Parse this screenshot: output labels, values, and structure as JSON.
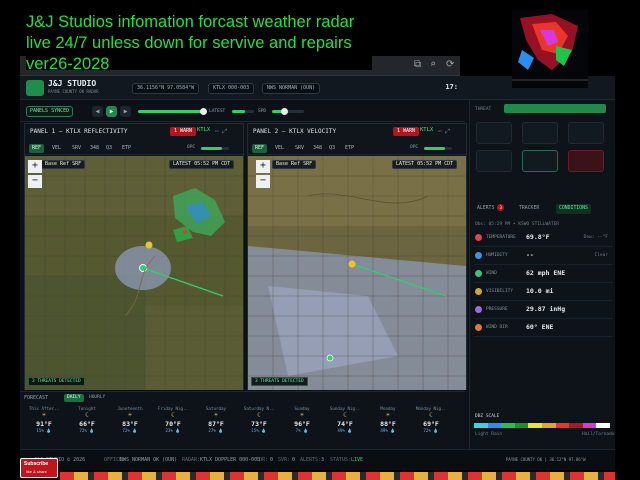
{
  "overlay": {
    "line1": "J&J Studios infomation forcast weather radar",
    "line2": "live 24/7 unless down for servive and repairs",
    "line3": "ver26-2028"
  },
  "app": {
    "brand": "J&J STUDIO",
    "brand_sub": "PAYNE COUNTY OK RADAR",
    "coords": "36.1156°N 97.0584°W",
    "site_code": "KTLX 000-003",
    "location": "NWS NORMAN (OUN)",
    "clock": "17:"
  },
  "controls": {
    "panels_synced": "PANELS SYNCED",
    "latest": "LATEST",
    "spd": "SPD"
  },
  "panels": [
    {
      "title": "PANEL 1 — KTLX REFLECTIVITY",
      "warn": "1 WARN",
      "site": "KTLX",
      "products": [
        "REF",
        "VEL",
        "SRV",
        "348",
        "Q3",
        "ETP"
      ],
      "layer": "Base Ref",
      "layer_tag": "SRF",
      "timestamp": "LATEST  05:52 PM CDT",
      "threats": "3 THREATS DETECTED",
      "opc": "OPC"
    },
    {
      "title": "PANEL 2 — KTLX VELOCITY",
      "warn": "1 WARN",
      "site": "KTLX",
      "products": [
        "REF",
        "VEL",
        "SRV",
        "348",
        "Q3",
        "ETP"
      ],
      "layer": "Base Ref",
      "layer_tag": "SRF",
      "timestamp": "LATEST  05:52 PM CDT",
      "threats": "3 THREATS DETECTED",
      "opc": "OPC"
    }
  ],
  "right_panel": {
    "threat_label": "THREAT",
    "tabs": [
      "ALERTS",
      "TRACKER",
      "CONDITIONS"
    ],
    "alerts_count": "3",
    "station": "Obs: 05:29 PM • KSWO STILLWATER",
    "conditions": [
      {
        "key": "TEMPERATURE",
        "value": "69.8°F",
        "extra": "Dew: --°F",
        "color": "#e0454a"
      },
      {
        "key": "HUMIDITY",
        "value": "--",
        "extra": "Clear",
        "color": "#4a90d9"
      },
      {
        "key": "WIND",
        "value": "62 mph ENE",
        "extra": "",
        "color": "#3fbf7a"
      },
      {
        "key": "VISIBILITY",
        "value": "10.0 mi",
        "extra": "",
        "color": "#d0a640"
      },
      {
        "key": "PRESSURE",
        "value": "29.87 inHg",
        "extra": "",
        "color": "#9b6bdb"
      },
      {
        "key": "WIND DIR",
        "value": "60° ENE",
        "extra": "",
        "color": "#e07a3a"
      }
    ],
    "scale_title": "DBZ SCALE",
    "scale_left": "Light Rain",
    "scale_right": "Hail/Tornado",
    "scale_colors": [
      "#3ad2e8",
      "#2a8ef0",
      "#21c44a",
      "#10962c",
      "#e6e62a",
      "#e8a424",
      "#e8362a",
      "#b01428",
      "#d838d8",
      "#ffffff"
    ]
  },
  "forecast": {
    "label": "FORECAST",
    "tab_daily": "DAILY",
    "tab_hourly": "HOURLY",
    "days": [
      {
        "name": "This After..",
        "icon": "☀",
        "temp": "91°F",
        "rain": "15% 💧"
      },
      {
        "name": "Tonight",
        "icon": "☾",
        "temp": "66°F",
        "rain": "72% 💧"
      },
      {
        "name": "Juneteenth",
        "icon": "☀",
        "temp": "83°F",
        "rain": "72% 💧"
      },
      {
        "name": "Friday Nig..",
        "icon": "☾",
        "temp": "70°F",
        "rain": "23% 💧"
      },
      {
        "name": "Saturday",
        "icon": "☀",
        "temp": "87°F",
        "rain": "27% 💧"
      },
      {
        "name": "Saturday N..",
        "icon": "☾",
        "temp": "73°F",
        "rain": "15% 💧"
      },
      {
        "name": "Sunday",
        "icon": "☀",
        "temp": "96°F",
        "rain": "7% 💧"
      },
      {
        "name": "Sunday Nig..",
        "icon": "☾",
        "temp": "74°F",
        "rain": "49% 💧"
      },
      {
        "name": "Monday",
        "icon": "☀",
        "temp": "88°F",
        "rain": "49% 💧"
      },
      {
        "name": "Monday Nig..",
        "icon": "☾",
        "temp": "69°F",
        "rain": "72% 💧"
      }
    ]
  },
  "statusbar": {
    "left": "J&J STUDIO © 2026",
    "office": "NWS NORMAN OK (OUN)",
    "radar": "KTLX DOPPLER 000-003",
    "tor": "0",
    "svr": "0",
    "alerts": "3",
    "status": "LIVE",
    "right": "PAYNE COUNTY OK | 36.12°N 97.06°W"
  },
  "youtube": {
    "line1": "Subscribe",
    "line2": "like & share"
  },
  "colors": {
    "accent": "#2fd06c",
    "warn": "#b4141e",
    "overlay_text": "#22e040"
  }
}
